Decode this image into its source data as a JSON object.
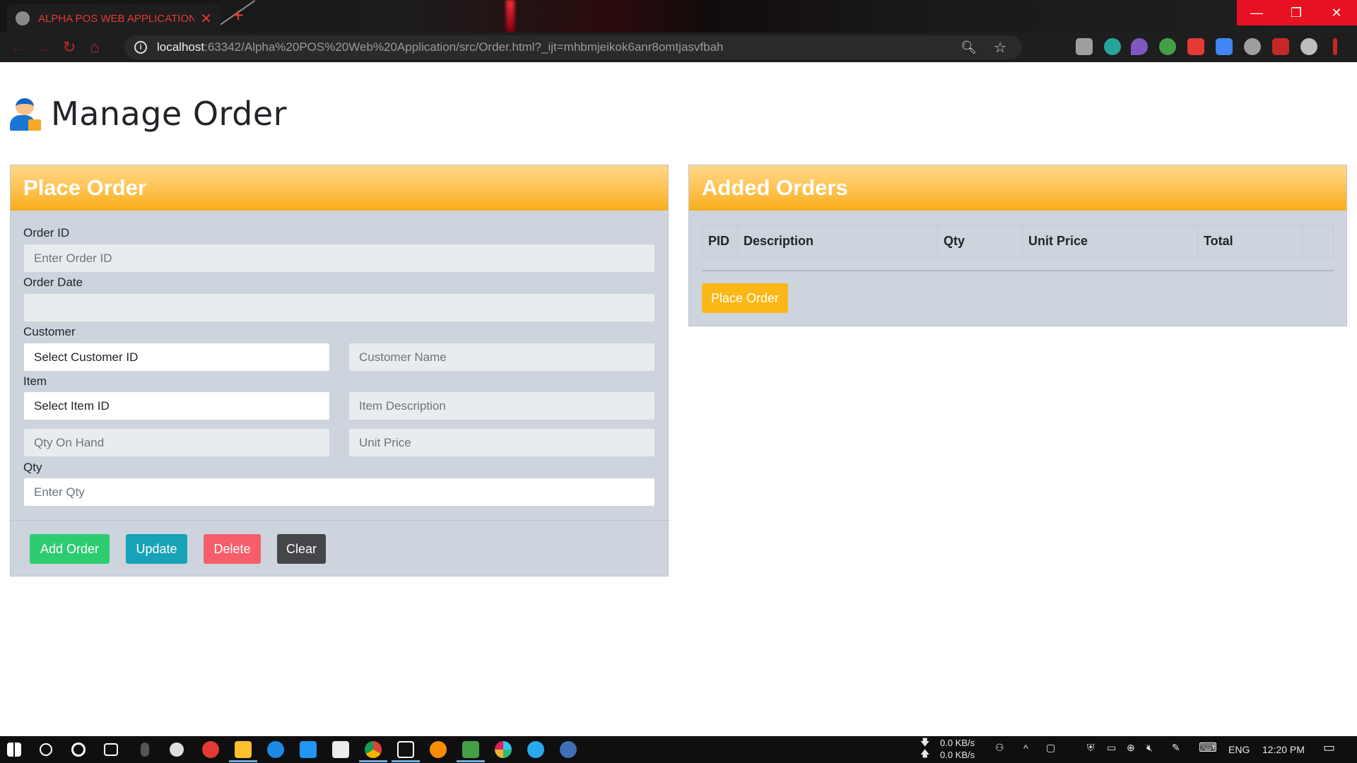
{
  "browser": {
    "tab_title": "ALPHA POS WEB APPLICATION",
    "url_host": "localhost",
    "url_path": ":63342/Alpha%20POS%20Web%20Application/src/Order.html?_ijt=mhbmjeikok6anr8omtjasvfbah"
  },
  "page": {
    "title": "Manage Order"
  },
  "place_order": {
    "header": "Place Order",
    "order_id_label": "Order ID",
    "order_id_placeholder": "Enter Order ID",
    "order_date_label": "Order Date",
    "order_date_value": "",
    "customer_label": "Customer",
    "customer_select": "Select Customer ID",
    "customer_name_placeholder": "Customer Name",
    "item_label": "Item",
    "item_select": "Select Item ID",
    "item_description_placeholder": "Item Description",
    "qty_on_hand_placeholder": "Qty On Hand",
    "unit_price_placeholder": "Unit Price",
    "qty_label": "Qty",
    "qty_placeholder": "Enter Qty",
    "buttons": {
      "add": "Add Order",
      "update": "Update",
      "delete": "Delete",
      "clear": "Clear"
    }
  },
  "added_orders": {
    "header": "Added Orders",
    "columns": [
      "PID",
      "Description",
      "Qty",
      "Unit Price",
      "Total",
      ""
    ],
    "place_order_button": "Place Order"
  },
  "taskbar": {
    "net_down": "0.0 KB/s",
    "net_up": "0.0 KB/s",
    "language": "ENG",
    "time": "12:20 PM"
  },
  "colors": {
    "card_bg": "#cdd4dd",
    "header_orange": "#f9ad1a",
    "add": "#2ecc71",
    "update": "#17a2b8",
    "delete": "#f75e6c",
    "clear": "#444649",
    "place": "#fbb715"
  }
}
